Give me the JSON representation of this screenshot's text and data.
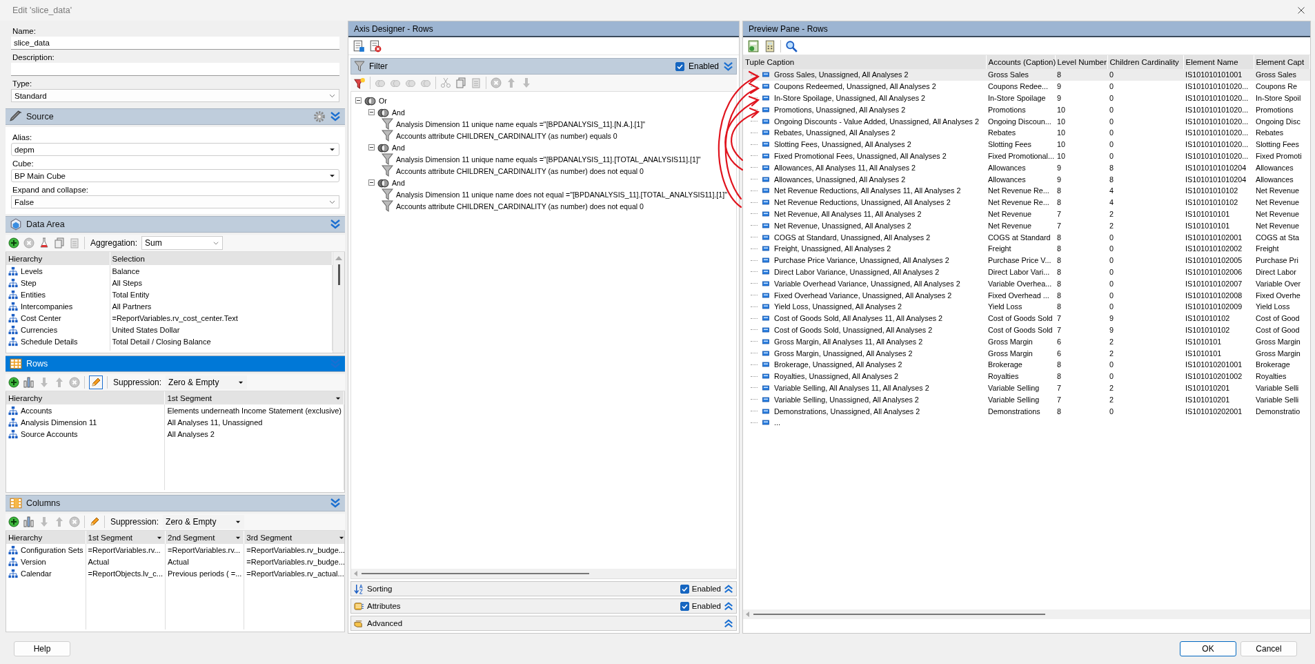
{
  "window": {
    "title": "Edit 'slice_data'"
  },
  "general": {
    "fields": [
      {
        "label": "Name:",
        "value": "slice_data",
        "kind": "text"
      },
      {
        "label": "Description:",
        "kind": "text"
      },
      {
        "label": "Type:",
        "value": "Standard",
        "kind": "select"
      }
    ]
  },
  "source": {
    "title": "Source",
    "selected": false,
    "fields": [
      {
        "label": "Alias:",
        "value": "depm",
        "kind": "dropdown"
      },
      {
        "label": "Cube:",
        "value": "BP Main Cube",
        "kind": "dropdown"
      },
      {
        "label": "Expand and collapse:",
        "value": "False",
        "kind": "select"
      }
    ]
  },
  "data_area": {
    "title": "Data Area",
    "selected": false,
    "option_label": "Aggregation:",
    "option_value": "Sum",
    "columns": [
      {
        "label": "Hierarchy",
        "menu": false
      },
      {
        "label": "Selection",
        "menu": false
      }
    ],
    "rows": [
      [
        "Levels",
        "Balance"
      ],
      [
        "Step",
        "All Steps"
      ],
      [
        "Entities",
        "Total Entity"
      ],
      [
        "Intercompanies",
        "All Partners"
      ],
      [
        "Cost Center",
        "=ReportVariables.rv_cost_center.Text"
      ],
      [
        "Currencies",
        "United States Dollar"
      ],
      [
        "Schedule Details",
        "Total Detail / Closing Balance"
      ]
    ]
  },
  "rows_section": {
    "title": "Rows",
    "selected": true,
    "option_label": "Suppression:",
    "option_value": "Zero & Empty",
    "columns": [
      {
        "label": "Hierarchy",
        "menu": false
      },
      {
        "label": "1st Segment",
        "menu": true
      }
    ],
    "rows": [
      [
        "Accounts",
        "Elements underneath Income Statement (exclusive)"
      ],
      [
        "Analysis Dimension 11",
        "All Analyses 11, Unassigned"
      ],
      [
        "Source Accounts",
        "All Analyses 2"
      ]
    ]
  },
  "columns_section": {
    "title": "Columns",
    "selected": false,
    "option_label": "Suppression:",
    "option_value": "Zero & Empty",
    "columns": [
      {
        "label": "Hierarchy",
        "menu": false
      },
      {
        "label": "1st Segment",
        "menu": true
      },
      {
        "label": "2nd Segment",
        "menu": true
      },
      {
        "label": "3rd Segment",
        "menu": true
      }
    ],
    "rows": [
      [
        "Configuration Sets",
        "=ReportVariables.rv...",
        "=ReportVariables.rv...",
        "=ReportVariables.rv_budge..."
      ],
      [
        "Version",
        "Actual",
        "Actual",
        "=ReportVariables.rv_budge..."
      ],
      [
        "Calendar",
        "=ReportObjects.lv_c...",
        "Previous periods ( =...",
        "=ReportVariables.rv_actual..."
      ]
    ]
  },
  "axis_designer": {
    "title": "Axis Designer - Rows",
    "filter": {
      "title": "Filter",
      "enabled": true,
      "enabled_label": "Enabled",
      "tree": [
        {
          "label": "Or",
          "kind": "group",
          "expanded": true,
          "children": [
            {
              "label": "And",
              "kind": "group",
              "expanded": true,
              "children": [
                {
                  "label": "Analysis Dimension 11 unique name equals =\"[BPDANALYSIS_11].[N.A.].[1]\"",
                  "kind": "condition"
                },
                {
                  "label": "Accounts attribute CHILDREN_CARDINALITY (as number) equals 0",
                  "kind": "condition"
                }
              ]
            },
            {
              "label": "And",
              "kind": "group",
              "expanded": true,
              "children": [
                {
                  "label": "Analysis Dimension 11 unique name equals =\"[BPDANALYSIS_11].[TOTAL_ANALYSIS11].[1]\"",
                  "kind": "condition"
                },
                {
                  "label": "Accounts attribute CHILDREN_CARDINALITY (as number) does not equal 0",
                  "kind": "condition"
                }
              ]
            },
            {
              "label": "And",
              "kind": "group",
              "expanded": true,
              "children": [
                {
                  "label": "Analysis Dimension 11 unique name does not equal =\"[BPDANALYSIS_11].[TOTAL_ANALYSIS11].[1]\"",
                  "kind": "condition"
                },
                {
                  "label": "Accounts attribute CHILDREN_CARDINALITY (as number) does not equal 0",
                  "kind": "condition"
                }
              ]
            }
          ]
        }
      ]
    },
    "sections": [
      {
        "title": "Sorting",
        "kind": "toggle",
        "enabled": true,
        "enabled_label": "Enabled"
      },
      {
        "title": "Attributes",
        "kind": "toggle",
        "enabled": true,
        "enabled_label": "Enabled"
      },
      {
        "title": "Advanced",
        "kind": "plain"
      }
    ]
  },
  "preview": {
    "title": "Preview Pane - Rows",
    "columns": [
      "Tuple Caption",
      "Accounts (Caption)",
      "Level Number",
      "Children Cardinality",
      "Element Name",
      "Element Capt"
    ],
    "rows": [
      {
        "selected": true,
        "cells": [
          "Gross Sales, Unassigned, All Analyses 2",
          "Gross Sales",
          "8",
          "0",
          "IS101010101001",
          "Gross Sales"
        ]
      },
      {
        "selected": false,
        "cells": [
          "Coupons Redeemed, Unassigned, All Analyses 2",
          "Coupons Redee...",
          "9",
          "0",
          "IS101010101020...",
          "Coupons Re"
        ]
      },
      {
        "selected": false,
        "cells": [
          "In-Store Spoilage, Unassigned, All Analyses 2",
          "In-Store Spoilage",
          "9",
          "0",
          "IS101010101020...",
          "In-Store Spoil"
        ]
      },
      {
        "selected": false,
        "cells": [
          "Promotions, Unassigned, All Analyses 2",
          "Promotions",
          "10",
          "0",
          "IS101010101020...",
          "Promotions"
        ]
      },
      {
        "selected": false,
        "cells": [
          "Ongoing Discounts - Value Added, Unassigned, All Analyses 2",
          "Ongoing Discoun...",
          "10",
          "0",
          "IS101010101020...",
          "Ongoing Disc"
        ]
      },
      {
        "selected": false,
        "cells": [
          "Rebates, Unassigned, All Analyses 2",
          "Rebates",
          "10",
          "0",
          "IS101010101020...",
          "Rebates"
        ]
      },
      {
        "selected": false,
        "cells": [
          "Slotting Fees, Unassigned, All Analyses 2",
          "Slotting Fees",
          "10",
          "0",
          "IS101010101020...",
          "Slotting Fees"
        ]
      },
      {
        "selected": false,
        "cells": [
          "Fixed Promotional Fees, Unassigned, All Analyses 2",
          "Fixed Promotional...",
          "10",
          "0",
          "IS101010101020...",
          "Fixed Promoti"
        ]
      },
      {
        "selected": false,
        "cells": [
          "Allowances, All Analyses 11, All Analyses 2",
          "Allowances",
          "9",
          "8",
          "IS1010101010204",
          "Allowances"
        ]
      },
      {
        "selected": false,
        "cells": [
          "Allowances, Unassigned, All Analyses 2",
          "Allowances",
          "9",
          "8",
          "IS1010101010204",
          "Allowances"
        ]
      },
      {
        "selected": false,
        "cells": [
          "Net Revenue Reductions, All Analyses 11, All Analyses 2",
          "Net Revenue Re...",
          "8",
          "4",
          "IS10101010102",
          "Net Revenue"
        ]
      },
      {
        "selected": false,
        "cells": [
          "Net Revenue Reductions, Unassigned, All Analyses 2",
          "Net Revenue Re...",
          "8",
          "4",
          "IS10101010102",
          "Net Revenue"
        ]
      },
      {
        "selected": false,
        "cells": [
          "Net Revenue, All Analyses 11, All Analyses 2",
          "Net Revenue",
          "7",
          "2",
          "IS101010101",
          "Net Revenue"
        ]
      },
      {
        "selected": false,
        "cells": [
          "Net Revenue, Unassigned, All Analyses 2",
          "Net Revenue",
          "7",
          "2",
          "IS101010101",
          "Net Revenue"
        ]
      },
      {
        "selected": false,
        "cells": [
          "COGS at Standard, Unassigned, All Analyses 2",
          "COGS at Standard",
          "8",
          "0",
          "IS101010102001",
          "COGS at Sta"
        ]
      },
      {
        "selected": false,
        "cells": [
          "Freight, Unassigned, All Analyses 2",
          "Freight",
          "8",
          "0",
          "IS101010102002",
          "Freight"
        ]
      },
      {
        "selected": false,
        "cells": [
          "Purchase Price Variance, Unassigned, All Analyses 2",
          "Purchase Price V...",
          "8",
          "0",
          "IS101010102005",
          "Purchase Pri"
        ]
      },
      {
        "selected": false,
        "cells": [
          "Direct Labor Variance, Unassigned, All Analyses 2",
          "Direct Labor Vari...",
          "8",
          "0",
          "IS101010102006",
          "Direct Labor"
        ]
      },
      {
        "selected": false,
        "cells": [
          "Variable Overhead Variance, Unassigned, All Analyses 2",
          "Variable Overhea...",
          "8",
          "0",
          "IS101010102007",
          "Variable Over"
        ]
      },
      {
        "selected": false,
        "cells": [
          "Fixed Overhead Variance, Unassigned, All Analyses 2",
          "Fixed Overhead ...",
          "8",
          "0",
          "IS101010102008",
          "Fixed Overhe"
        ]
      },
      {
        "selected": false,
        "cells": [
          "Yield Loss, Unassigned, All Analyses 2",
          "Yield Loss",
          "8",
          "0",
          "IS101010102009",
          "Yield Loss"
        ]
      },
      {
        "selected": false,
        "cells": [
          "Cost of Goods Sold, All Analyses 11, All Analyses 2",
          "Cost of Goods Sold",
          "7",
          "9",
          "IS101010102",
          "Cost of Good"
        ]
      },
      {
        "selected": false,
        "cells": [
          "Cost of Goods Sold, Unassigned, All Analyses 2",
          "Cost of Goods Sold",
          "7",
          "9",
          "IS101010102",
          "Cost of Good"
        ]
      },
      {
        "selected": false,
        "cells": [
          "Gross Margin, All Analyses 11, All Analyses 2",
          "Gross Margin",
          "6",
          "2",
          "IS1010101",
          "Gross Margin"
        ]
      },
      {
        "selected": false,
        "cells": [
          "Gross Margin, Unassigned, All Analyses 2",
          "Gross Margin",
          "6",
          "2",
          "IS1010101",
          "Gross Margin"
        ]
      },
      {
        "selected": false,
        "cells": [
          "Brokerage, Unassigned, All Analyses 2",
          "Brokerage",
          "8",
          "0",
          "IS101010201001",
          "Brokerage"
        ]
      },
      {
        "selected": false,
        "cells": [
          "Royalties, Unassigned, All Analyses 2",
          "Royalties",
          "8",
          "0",
          "IS101010201002",
          "Royalties"
        ]
      },
      {
        "selected": false,
        "cells": [
          "Variable Selling, All Analyses 11, All Analyses 2",
          "Variable Selling",
          "7",
          "2",
          "IS101010201",
          "Variable Selli"
        ]
      },
      {
        "selected": false,
        "cells": [
          "Variable Selling, Unassigned, All Analyses 2",
          "Variable Selling",
          "7",
          "2",
          "IS101010201",
          "Variable Selli"
        ]
      },
      {
        "selected": false,
        "cells": [
          "Demonstrations, Unassigned, All Analyses 2",
          "Demonstrations",
          "8",
          "0",
          "IS101010202001",
          "Demonstratio"
        ]
      },
      {
        "selected": false,
        "cells": [
          "..."
        ]
      }
    ]
  },
  "footer": {
    "help": "Help",
    "ok": "OK",
    "cancel": "Cancel"
  }
}
